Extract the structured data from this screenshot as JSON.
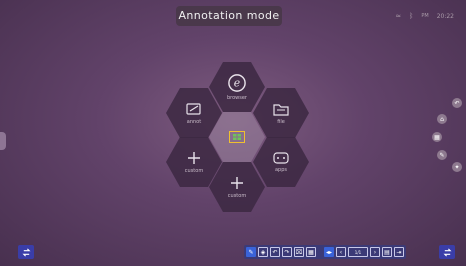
{
  "header": {
    "title": "Annotation mode"
  },
  "status_bar": {
    "wifi_icon": "wifi-icon",
    "bluetooth_icon": "bluetooth-icon",
    "time": "20:22",
    "ampm": "PM"
  },
  "launcher": {
    "browser": {
      "label": "browser",
      "icon": "browser-e-icon"
    },
    "whiteboard": {
      "label": "annot",
      "icon": "whiteboard-icon"
    },
    "file": {
      "label": "file",
      "icon": "folder-icon"
    },
    "source": {
      "label": "",
      "icon": "windows-source-icon"
    },
    "custom_left": {
      "label": "custom",
      "icon": "plus-icon"
    },
    "apps": {
      "label": "apps",
      "icon": "apps-icon"
    },
    "custom_bottom": {
      "label": "custom",
      "icon": "plus-icon"
    }
  },
  "toolbar": {
    "tools": [
      "pen",
      "eraser",
      "undo",
      "redo",
      "screenshot",
      "qr-code",
      "nav",
      "prev-page",
      "page-indicator",
      "next-page",
      "whiteboard",
      "exit"
    ],
    "page_indicator": "1/1"
  },
  "colors": {
    "accent": "#3a63d9",
    "background": "#62436a",
    "corner_button": "#3a3da8"
  }
}
